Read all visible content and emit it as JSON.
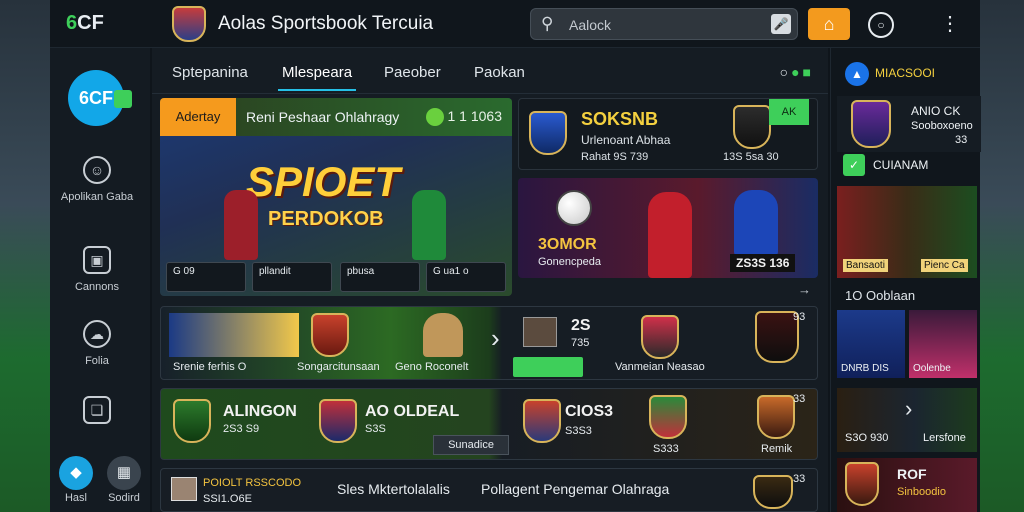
{
  "header": {
    "logo": "6CF",
    "title": "Aolas Sportsbook Tercuia",
    "search_placeholder": "Aalock",
    "icons": [
      "search-icon",
      "mic-icon",
      "home-icon",
      "clock-icon",
      "more-icon"
    ]
  },
  "rail": {
    "logo": "6CF",
    "items": [
      {
        "label": "Apolikan Gaba",
        "icon": "smile-icon"
      },
      {
        "label": "Cannons",
        "icon": "camera-icon"
      },
      {
        "label": "Folia",
        "icon": "cloud-icon"
      },
      {
        "label": "",
        "icon": "bookmark-icon"
      }
    ],
    "bottom": [
      {
        "label": "Hasl",
        "icon": "diamond-icon"
      },
      {
        "label": "Sodird",
        "icon": "grid-icon"
      }
    ]
  },
  "tabs": [
    {
      "label": "Sptepanina"
    },
    {
      "label": "Mlespeara"
    },
    {
      "label": "Paeober"
    },
    {
      "label": "Paokan"
    }
  ],
  "hero": {
    "tag": "Adertay",
    "head_title": "Reni Peshaar Ohlahragy",
    "head_score": "1 1 1063",
    "title": "SPIOET",
    "subtitle": "PERDOKOB",
    "buttons": [
      {
        "label": "G 09"
      },
      {
        "label": "pllandit"
      },
      {
        "label": "pbusa"
      },
      {
        "label": "G ua1 o"
      }
    ]
  },
  "match1": {
    "title": "SOKSNB",
    "subtitle": "Urlenoant Abhaa",
    "meta": "Rahat 9S 739",
    "meta2": "13S 5sa 30",
    "live": "AK"
  },
  "match2": {
    "title": "3OMOR",
    "subtitle": "Gonencpeda",
    "code": "ZS3S 136"
  },
  "promo": {
    "left_label": "Srenie ferhis O",
    "mid_label": "Songarcitunsaan",
    "mid2_label": "Geno Roconelt",
    "score": "2S",
    "score_sub": "735",
    "right_label": "Vanmeian Neasao",
    "num": "93"
  },
  "league": {
    "title": "ALINGON",
    "title_sub": "2S3 S9",
    "title2": "AO OLDEAL",
    "title2_sub": "S3S",
    "button": "Sunadice",
    "team3": "CIOS3",
    "team3_sub": "S3S3",
    "team4_sub": "S333",
    "team5_sub": "Remik",
    "num": "33"
  },
  "bottom_row": {
    "label1": "POIOLT RSSCODO",
    "label1_sub": "SSI1.O6E",
    "label2": "Sles Mktertolalalis",
    "label3": "Pollagent Pengemar Olahraga",
    "num": "33"
  },
  "right_panel": {
    "head": "MIACSOOI",
    "team_title": "ANIO CK",
    "team_sub": "Sooboxoeno",
    "team_num": "33",
    "row_label": "CUIANAM",
    "photo_cap1": "Bansaoti",
    "photo_cap2": "Pienc Ca",
    "section": "1O Ooblaan",
    "tiles": [
      {
        "cap": "DNRB DIS"
      },
      {
        "cap": "Oolenbe"
      }
    ],
    "bar_left": "S3O 930",
    "bar_right": "Lersfone",
    "bar2_left": "ROF",
    "bar2_sub": "Sinboodio"
  },
  "colors": {
    "accent": "#26c0e6",
    "orange": "#f39a1e",
    "green": "#3ecf5a",
    "gold": "#f4d03f"
  }
}
